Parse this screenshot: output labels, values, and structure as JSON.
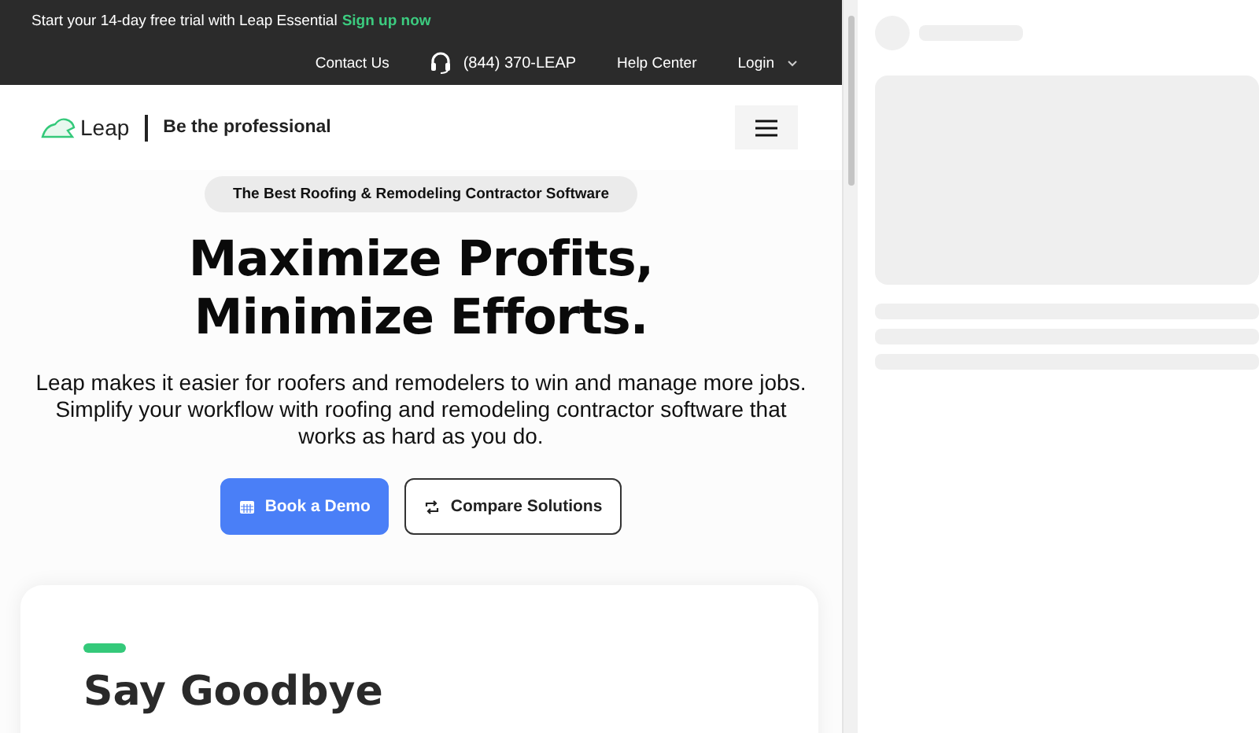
{
  "promo_bar": {
    "text": "Start your 14-day free trial with Leap Essential",
    "link": "Sign up now"
  },
  "top_nav": {
    "contact": "Contact Us",
    "phone": "(844) 370-LEAP",
    "help": "Help Center",
    "login": "Login"
  },
  "header": {
    "logo": "Leap",
    "tagline": "Be the professional"
  },
  "hero": {
    "badge": "The Best Roofing & Remodeling Contractor Software",
    "title": "Maximize Profits, Minimize Efforts.",
    "description": "Leap makes it easier for roofers and remodelers to win and manage more jobs. Simplify your workflow with roofing and remodeling contractor software that works as hard as you do.",
    "buttons": [
      {
        "label": "Book a Demo",
        "kind": "primary"
      },
      {
        "label": "Compare Solutions",
        "kind": "secondary"
      }
    ]
  },
  "card": {
    "heading": "Say Goodbye"
  }
}
